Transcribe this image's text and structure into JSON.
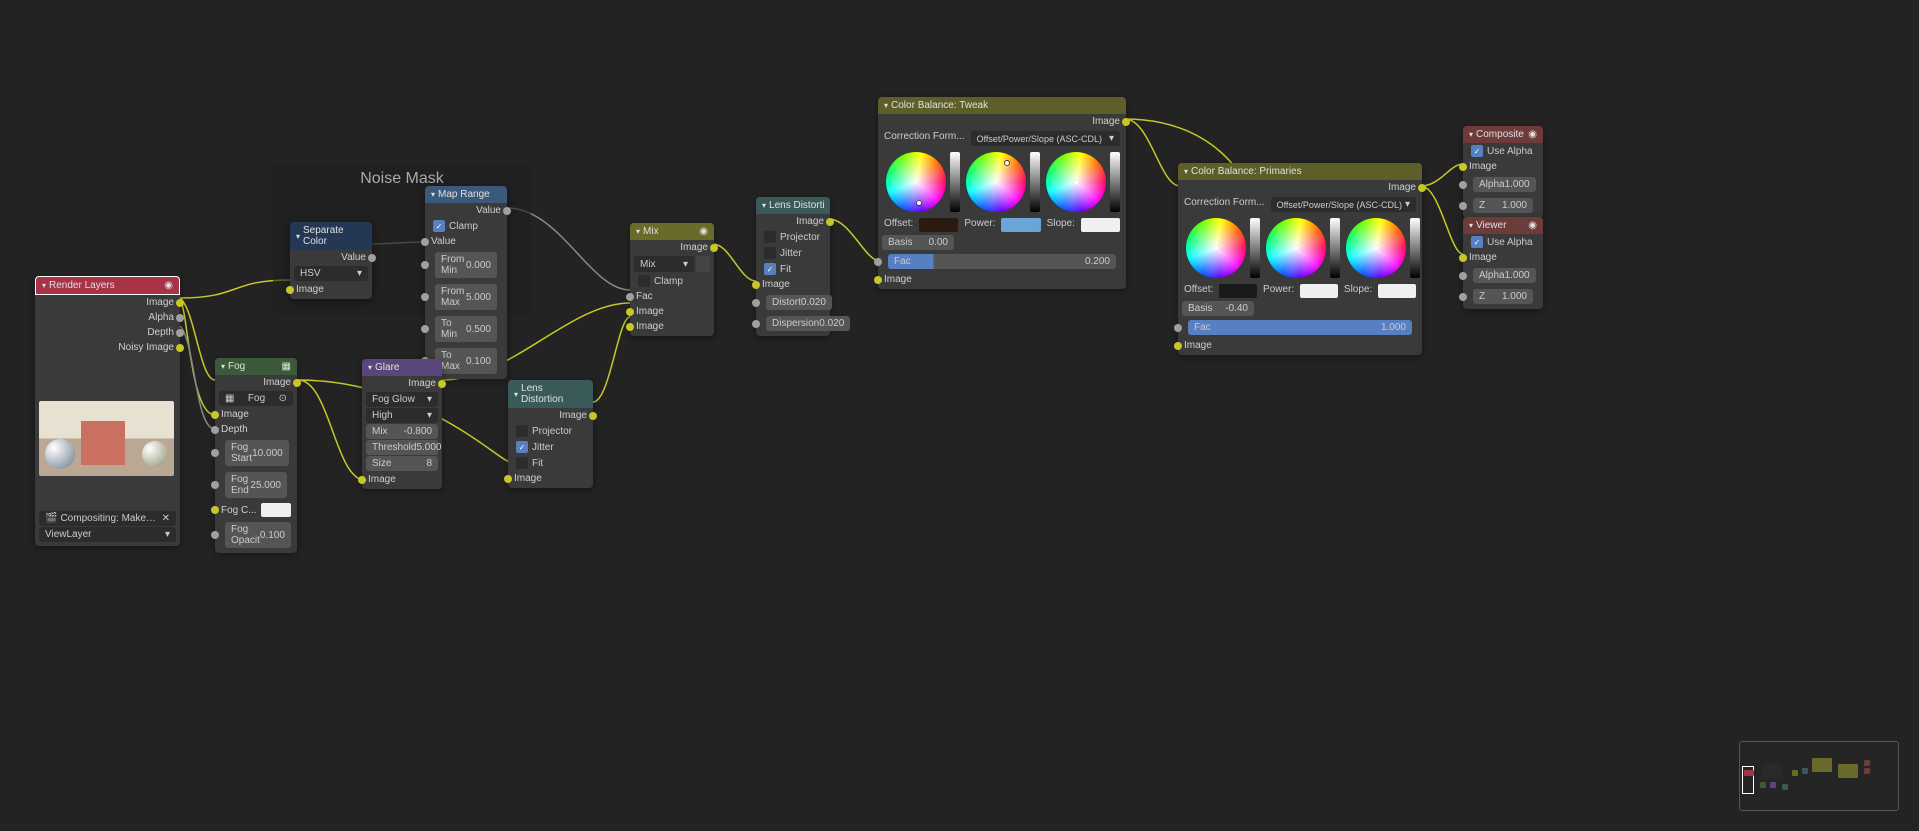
{
  "frame": {
    "label": "Noise Mask"
  },
  "nodes": {
    "render_layers": {
      "title": "Render Layers",
      "outputs": [
        "Image",
        "Alpha",
        "Depth",
        "Noisy Image"
      ],
      "scene_label": "Compositing: Make Renders ...",
      "viewlayer": "ViewLayer"
    },
    "separate_color": {
      "title": "Separate Color",
      "out": "Value",
      "mode": "HSV",
      "in": "Image"
    },
    "map_range": {
      "title": "Map Range",
      "out": "Value",
      "clamp_label": "Clamp",
      "clamp": true,
      "in_value": "Value",
      "from_min": {
        "label": "From Min",
        "value": "0.000"
      },
      "from_max": {
        "label": "From Max",
        "value": "5.000"
      },
      "to_min": {
        "label": "To Min",
        "value": "0.500"
      },
      "to_max": {
        "label": "To Max",
        "value": "0.100"
      }
    },
    "fog": {
      "title": "Fog",
      "out": "Image",
      "node_group": "Fog",
      "in_image": "Image",
      "in_depth": "Depth",
      "fog_start": {
        "label": "Fog Start",
        "value": "10.000"
      },
      "fog_end": {
        "label": "Fog End",
        "value": "25.000"
      },
      "fog_color": "Fog C...",
      "fog_opacity": {
        "label": "Fog Opacit",
        "value": "0.100"
      }
    },
    "glare": {
      "title": "Glare",
      "out": "Image",
      "type": "Fog Glow",
      "quality": "High",
      "mix": {
        "label": "Mix",
        "value": "-0.800"
      },
      "threshold": {
        "label": "Threshold",
        "value": "5.000"
      },
      "size": {
        "label": "Size",
        "value": "8"
      },
      "in": "Image"
    },
    "lens_distortion1": {
      "title": "Lens Distortion",
      "out": "Image",
      "projector": {
        "label": "Projector",
        "checked": false
      },
      "jitter": {
        "label": "Jitter",
        "checked": true
      },
      "fit": {
        "label": "Fit",
        "checked": false
      },
      "in": "Image"
    },
    "mix": {
      "title": "Mix",
      "out": "Image",
      "mode": "Mix",
      "clamp": {
        "label": "Clamp",
        "checked": false
      },
      "in_fac": "Fac",
      "in_image1": "Image",
      "in_image2": "Image"
    },
    "lens_distortion2": {
      "title": "Lens Distortion",
      "out": "Image",
      "projector": {
        "label": "Projector",
        "checked": false
      },
      "jitter": {
        "label": "Jitter",
        "checked": false
      },
      "fit": {
        "label": "Fit",
        "checked": true
      },
      "in": "Image",
      "distort": {
        "label": "Distort",
        "value": "0.020"
      },
      "dispersion": {
        "label": "Dispersion",
        "value": "0.020"
      }
    },
    "color_balance1": {
      "title": "Color Balance: Tweak",
      "out": "Image",
      "formula_label": "Correction Form...",
      "formula": "Offset/Power/Slope (ASC-CDL)",
      "offset_label": "Offset:",
      "power_label": "Power:",
      "slope_label": "Slope:",
      "basis": {
        "label": "Basis",
        "value": "0.00"
      },
      "fac": {
        "label": "Fac",
        "value": "0.200"
      },
      "in": "Image",
      "swatches": {
        "offset": "#2a1a10",
        "power": "#6aa5d8",
        "slope": "#f0f0f0"
      }
    },
    "color_balance2": {
      "title": "Color Balance: Primaries",
      "out": "Image",
      "formula_label": "Correction Form...",
      "formula": "Offset/Power/Slope (ASC-CDL)",
      "offset_label": "Offset:",
      "power_label": "Power:",
      "slope_label": "Slope:",
      "basis": {
        "label": "Basis",
        "value": "-0.40"
      },
      "fac": {
        "label": "Fac",
        "value": "1.000"
      },
      "in": "Image",
      "swatches": {
        "offset": "#1a1a1a",
        "power": "#f0f0f0",
        "slope": "#f0f0f0"
      }
    },
    "composite": {
      "title": "Composite",
      "use_alpha": {
        "label": "Use Alpha",
        "checked": true
      },
      "in_image": "Image",
      "alpha": {
        "label": "Alpha",
        "value": "1.000"
      },
      "z": {
        "label": "Z",
        "value": "1.000"
      }
    },
    "viewer": {
      "title": "Viewer",
      "use_alpha": {
        "label": "Use Alpha",
        "checked": true
      },
      "in_image": "Image",
      "alpha": {
        "label": "Alpha",
        "value": "1.000"
      },
      "z": {
        "label": "Z",
        "value": "1.000"
      }
    }
  }
}
